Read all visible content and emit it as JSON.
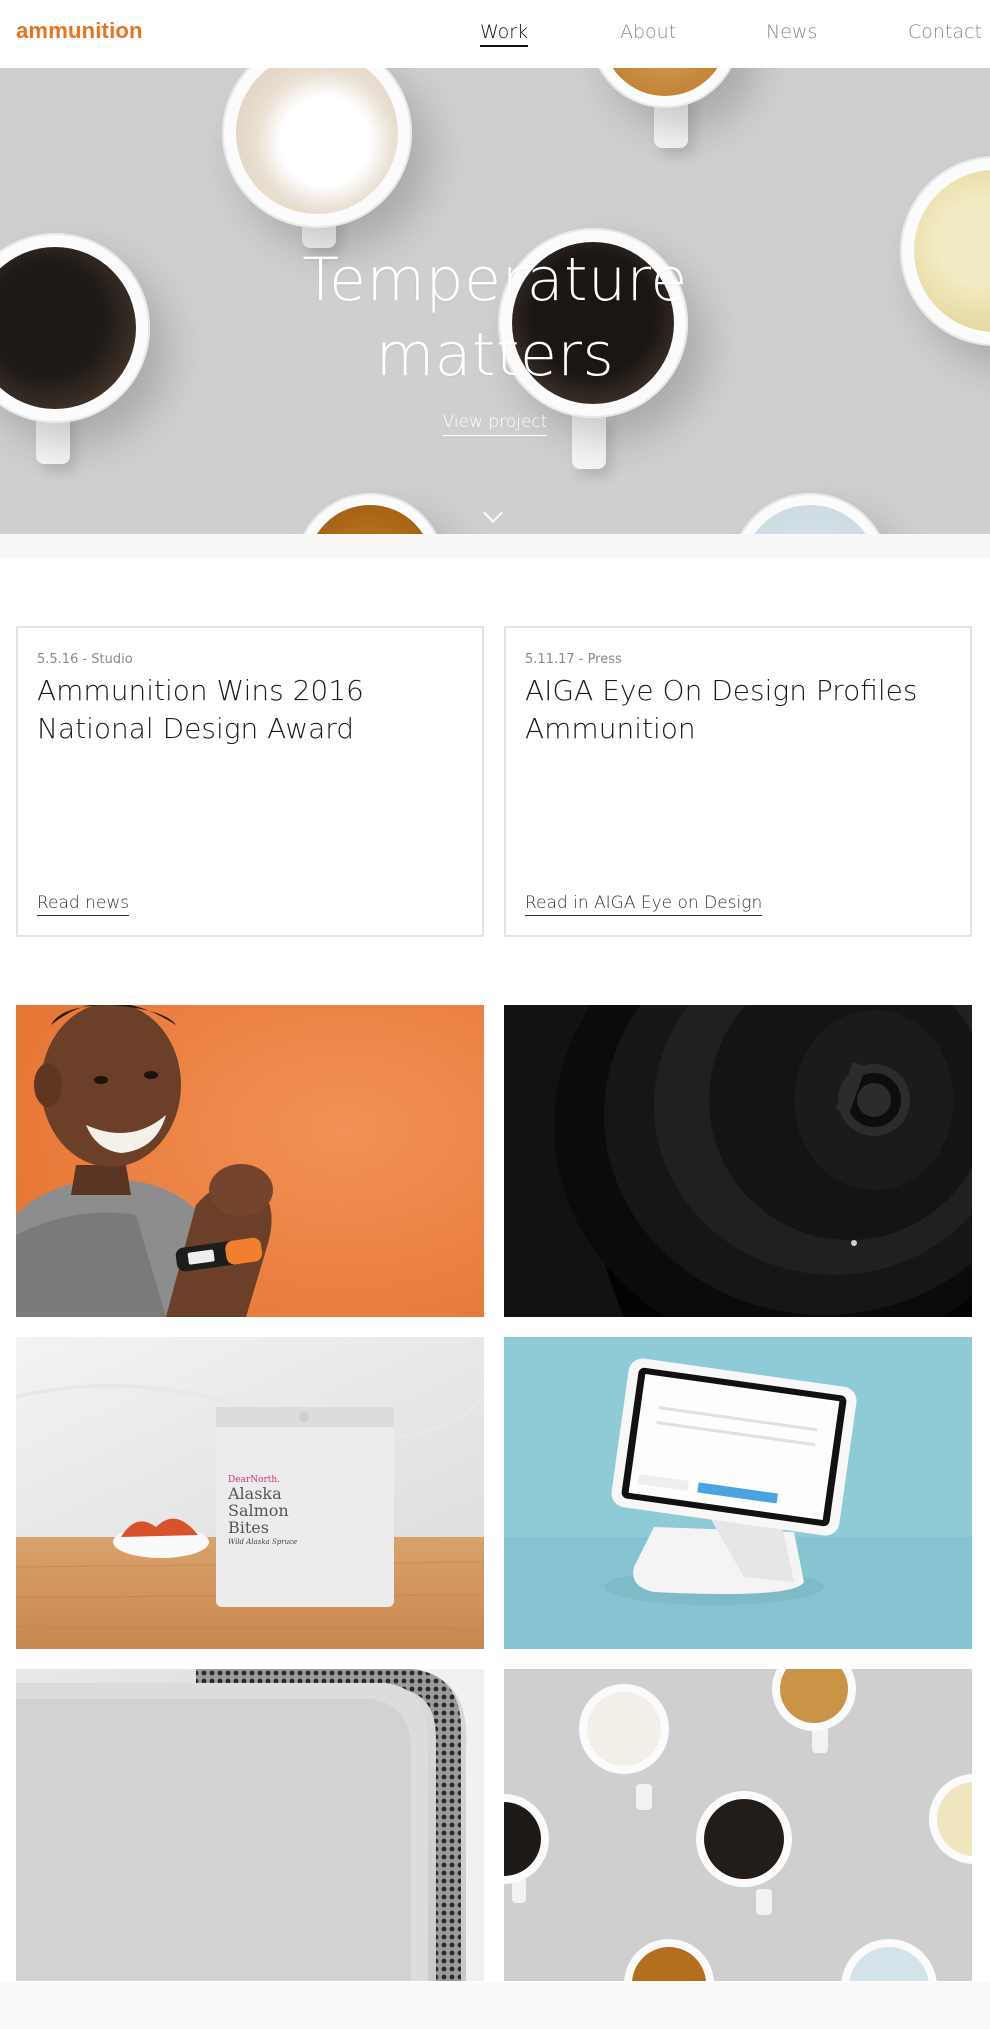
{
  "header": {
    "logo": "ammunition",
    "nav": [
      {
        "label": "Work",
        "active": true
      },
      {
        "label": "About",
        "active": false
      },
      {
        "label": "News",
        "active": false
      },
      {
        "label": "Contact",
        "active": false
      }
    ]
  },
  "hero": {
    "title_line1": "Temperature",
    "title_line2": "matters",
    "link": "View project",
    "scroll_icon": "chevron-down-icon"
  },
  "news": [
    {
      "meta": "5.5.16 - Studio",
      "title": "Ammunition Wins 2016 National Design Award",
      "link": "Read news"
    },
    {
      "meta": "5.11.17 - Press",
      "title": "AIGA Eye On Design Profiles Ammunition",
      "link": "Read in AIGA Eye on Design"
    }
  ],
  "tiles": [
    {
      "name": "fitness-band-kid"
    },
    {
      "name": "beats-headphones"
    },
    {
      "name": "salmon-bites-package"
    },
    {
      "name": "square-stand"
    },
    {
      "name": "speaker-mesh"
    },
    {
      "name": "coffee-cups"
    }
  ],
  "packaging": {
    "brand": "DearNorth.",
    "line1": "Alaska",
    "line2": "Salmon",
    "line3": "Bites",
    "flavor": "Wild Alaska Spruce"
  },
  "colors": {
    "brand": "#e8731e",
    "orange_bg": "#ef8446",
    "teal_bg": "#8fcad6"
  }
}
